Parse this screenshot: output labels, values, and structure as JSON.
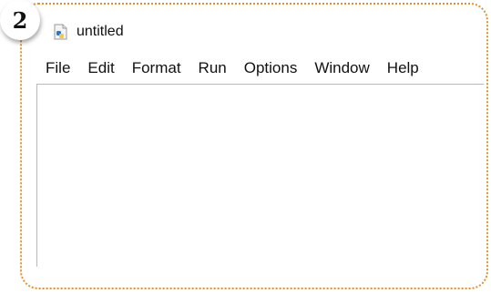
{
  "step": {
    "number": "2"
  },
  "window": {
    "title": "untitled",
    "icon": "python-icon"
  },
  "menubar": {
    "items": [
      "File",
      "Edit",
      "Format",
      "Run",
      "Options",
      "Window",
      "Help"
    ]
  },
  "editor": {
    "content": ""
  },
  "colors": {
    "border_accent": "#e2922a",
    "python_blue": "#3873b3",
    "python_yellow": "#f7c93e"
  }
}
